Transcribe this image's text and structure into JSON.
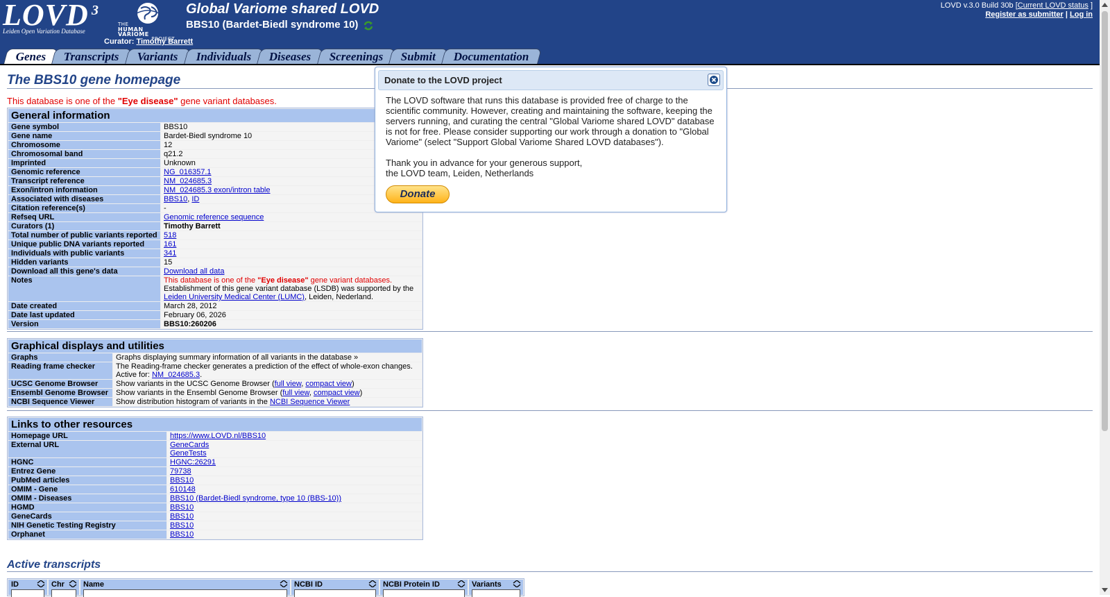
{
  "header": {
    "logo_text": "LOVD",
    "logo_superscript": "3",
    "logo_subtitle": "Leiden Open Variation Database",
    "hvp_lines": [
      "THE",
      "HUMAN VARIOME",
      "PROJECT"
    ],
    "site_title": "Global Variome shared LOVD",
    "gene_title": "BBS10 (Bardet-Biedl syndrome 10)",
    "curator_label": "Curator:",
    "curator_name": "Timothy Barrett",
    "version_text": "LOVD v.3.0 Build 30b [",
    "current_status_link": "Current LOVD status",
    "version_close": "]",
    "register_link": "Register as submitter",
    "separator": "|",
    "login_link": "Log in"
  },
  "tabs": [
    {
      "label": "Genes",
      "active": true
    },
    {
      "label": "Transcripts",
      "active": false
    },
    {
      "label": "Variants",
      "active": false
    },
    {
      "label": "Individuals",
      "active": false
    },
    {
      "label": "Diseases",
      "active": false
    },
    {
      "label": "Screenings",
      "active": false
    },
    {
      "label": "Submit",
      "active": false
    },
    {
      "label": "Documentation",
      "active": false
    }
  ],
  "page": {
    "heading": "The BBS10 gene homepage",
    "intro_prefix": "This database is one of the ",
    "intro_bold": "\"Eye disease\"",
    "intro_suffix": " gene variant databases."
  },
  "general_info": {
    "title": "General information",
    "rows": {
      "gene_symbol": {
        "label": "Gene symbol",
        "value": "BBS10"
      },
      "gene_name": {
        "label": "Gene name",
        "value": "Bardet-Biedl syndrome 10"
      },
      "chromosome": {
        "label": "Chromosome",
        "value": "12"
      },
      "chrom_band": {
        "label": "Chromosomal band",
        "value": "q21.2"
      },
      "imprinted": {
        "label": "Imprinted",
        "value": "Unknown"
      },
      "genomic_ref": {
        "label": "Genomic reference",
        "value": "NG_016357.1"
      },
      "transcript_ref": {
        "label": "Transcript reference",
        "value": "NM_024685.3"
      },
      "exon_intron": {
        "label": "Exon/intron information",
        "value": "NM_024685.3 exon/intron table"
      },
      "diseases": {
        "label": "Associated with diseases",
        "value1": "BBS10",
        "sep": ", ",
        "value2": "ID"
      },
      "citation": {
        "label": "Citation reference(s)",
        "value": "-"
      },
      "refseq_url": {
        "label": "Refseq URL",
        "value": "Genomic reference sequence"
      },
      "curators": {
        "label": "Curators (1)",
        "value": "Timothy Barrett"
      },
      "total_variants": {
        "label": "Total number of public variants reported",
        "value": "518"
      },
      "unique_variants": {
        "label": "Unique public DNA variants reported",
        "value": "161"
      },
      "individuals": {
        "label": "Individuals with public variants",
        "value": "341"
      },
      "hidden": {
        "label": "Hidden variants",
        "value": "15"
      },
      "download": {
        "label": "Download all this gene's data",
        "value": "Download all data"
      },
      "notes": {
        "label": "Notes",
        "line1_prefix": "This database is one of the ",
        "line1_bold": "\"Eye disease\"",
        "line1_suffix": " gene variant databases.",
        "line2": "Establishment of this gene variant database (LSDB) was supported by the",
        "line3_link": "Leiden University Medical Center (LUMC)",
        "line3_suffix": ", Leiden, Nederland."
      },
      "date_created": {
        "label": "Date created",
        "value": "March 28, 2012"
      },
      "date_updated": {
        "label": "Date last updated",
        "value": "February 06, 2026"
      },
      "version": {
        "label": "Version",
        "value": "BBS10:260206"
      }
    }
  },
  "graphical": {
    "title": "Graphical displays and utilities",
    "graphs": {
      "label": "Graphs",
      "value": "Graphs displaying summary information of all variants in the database »"
    },
    "reading_frame": {
      "label": "Reading frame checker",
      "line1": "The Reading-frame checker generates a prediction of the effect of whole-exon changes.",
      "active_prefix": "Active for: ",
      "active_link": "NM_024685.3",
      "active_suffix": "."
    },
    "ucsc": {
      "label": "UCSC Genome Browser",
      "prefix": "Show variants in the UCSC Genome Browser (",
      "full": "full view",
      "sep": ", ",
      "compact": "compact view",
      "suffix": ")"
    },
    "ensembl": {
      "label": "Ensembl Genome Browser",
      "prefix": "Show variants in the Ensembl Genome Browser (",
      "full": "full view",
      "sep": ", ",
      "compact": "compact view",
      "suffix": ")"
    },
    "ncbi": {
      "label": "NCBI Sequence Viewer",
      "prefix": "Show distribution histogram of variants in the ",
      "link": "NCBI Sequence Viewer"
    }
  },
  "links": {
    "title": "Links to other resources",
    "homepage": {
      "label": "Homepage URL",
      "value": "https://www.LOVD.nl/BBS10"
    },
    "external": {
      "label": "External URL",
      "value1": "GeneCards",
      "value2": "GeneTests"
    },
    "hgnc": {
      "label": "HGNC",
      "value": "HGNC:26291"
    },
    "entrez": {
      "label": "Entrez Gene",
      "value": "79738"
    },
    "pubmed": {
      "label": "PubMed articles",
      "value": "BBS10"
    },
    "omim_gene": {
      "label": "OMIM - Gene",
      "value": "610148"
    },
    "omim_diseases": {
      "label": "OMIM - Diseases",
      "value": "BBS10 (Bardet-Biedl syndrome, type 10 (BBS-10))"
    },
    "hgmd": {
      "label": "HGMD",
      "value": "BBS10"
    },
    "genecards": {
      "label": "GeneCards",
      "value": "BBS10"
    },
    "nih": {
      "label": "NIH Genetic Testing Registry",
      "value": "BBS10"
    },
    "orphanet": {
      "label": "Orphanet",
      "value": "BBS10"
    }
  },
  "transcripts": {
    "heading": "Active transcripts",
    "columns": [
      "ID",
      "Chr",
      "Name",
      "NCBI ID",
      "NCBI Protein ID",
      "Variants"
    ]
  },
  "modal": {
    "title": "Donate to the LOVD project",
    "para1": "The LOVD software that runs this database is provided free of charge to the scientific community. However, creating and maintaining the software, keeping the servers running, and curating the central \"Global Variome shared LOVD\" database is not for free. Please consider supporting our work through a donation to \"Global Variome\" (select \"Support Global Variome Shared LOVD databases\").",
    "para2_line1": "Thank you in advance for your generous support,",
    "para2_line2": "the LOVD team, Leiden, Netherlands",
    "donate_label": "Donate"
  },
  "colors": {
    "header_bg": "#224488",
    "label_bg": "#aac4ee",
    "heading": "#224488",
    "alert": "#e00000"
  },
  "icons": [
    "refresh-icon",
    "close-icon",
    "sort-icon",
    "scroll-up-icon",
    "scroll-down-icon"
  ]
}
